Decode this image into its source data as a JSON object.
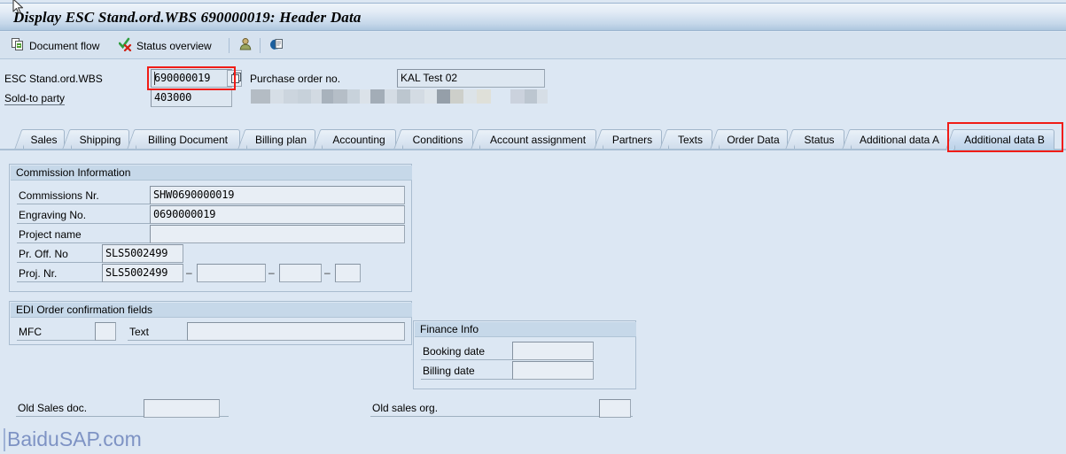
{
  "window": {
    "title": "Display ESC Stand.ord.WBS 690000019: Header Data"
  },
  "toolbar": {
    "items": [
      {
        "label": "Document flow",
        "icon": "document-flow-icon"
      },
      {
        "label": "Status overview",
        "icon": "status-overview-icon"
      },
      {
        "label": "",
        "icon": "partner-person-icon"
      },
      {
        "label": "",
        "icon": "display-document-icon"
      }
    ]
  },
  "header": {
    "doc_label": "ESC Stand.ord.WBS",
    "doc_value": "690000019",
    "po_label": "Purchase order no.",
    "po_value": "KAL Test 02",
    "soldto_label": "Sold-to party",
    "soldto_value": "403000",
    "soldto_name_redacted": true
  },
  "tabs": [
    {
      "label": "Sales",
      "active": false
    },
    {
      "label": "Shipping",
      "active": false
    },
    {
      "label": "Billing Document",
      "active": false
    },
    {
      "label": "Billing plan",
      "active": false
    },
    {
      "label": "Accounting",
      "active": false
    },
    {
      "label": "Conditions",
      "active": false
    },
    {
      "label": "Account assignment",
      "active": false
    },
    {
      "label": "Partners",
      "active": false
    },
    {
      "label": "Texts",
      "active": false
    },
    {
      "label": "Order Data",
      "active": false
    },
    {
      "label": "Status",
      "active": false
    },
    {
      "label": "Additional data A",
      "active": false
    },
    {
      "label": "Additional data B",
      "active": true
    }
  ],
  "commission_group": {
    "title": "Commission Information",
    "fields": {
      "commissions_nr_label": "Commissions Nr.",
      "commissions_nr_value": "SHW0690000019",
      "engraving_no_label": "Engraving No.",
      "engraving_no_value": "0690000019",
      "project_name_label": "Project name",
      "project_name_value": "",
      "pr_off_no_label": "Pr. Off. No",
      "pr_off_no_value": "SLS5002499",
      "proj_nr_label": "Proj. Nr.",
      "proj_nr_value_1": "SLS5002499",
      "proj_nr_value_2": "",
      "proj_nr_value_3": "",
      "proj_nr_value_4": "",
      "separator": "–"
    }
  },
  "edi_group": {
    "title": "EDI Order confirmation fields",
    "fields": {
      "mfc_label": "MFC",
      "mfc_value": "",
      "text_label": "Text",
      "text_value": ""
    }
  },
  "finance_group": {
    "title": "Finance Info",
    "fields": {
      "booking_date_label": "Booking date",
      "booking_date_value": "",
      "billing_date_label": "Billing date",
      "billing_date_value": ""
    }
  },
  "bottom": {
    "old_sales_doc_label": "Old Sales doc.",
    "old_sales_doc_value": "",
    "old_sales_org_label": "Old sales org.",
    "old_sales_org_value": ""
  },
  "watermark": {
    "text": "BaiduSAP.com"
  },
  "colors": {
    "background": "#dce7f3",
    "annotation_red": "#f01c16",
    "group_header": "#c6d8e9",
    "field_bg": "#dde7f1",
    "watermark": "#7e93c4"
  }
}
